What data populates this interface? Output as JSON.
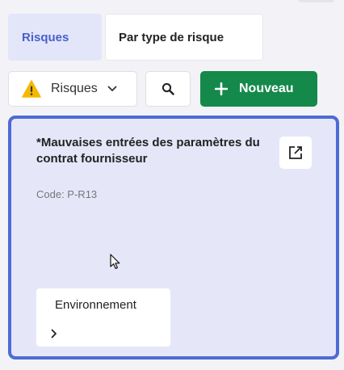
{
  "tabs": [
    {
      "label": "Risques",
      "active": true
    },
    {
      "label": "Par type de risque",
      "active": false
    }
  ],
  "toolbar": {
    "select_label": "Risques",
    "select_icon": "warning-icon",
    "search_icon": "search-icon",
    "new_label": "Nouveau",
    "new_icon": "plus-icon"
  },
  "card": {
    "title": "*Mauvaises entrées des paramètres du contrat fournisseur",
    "code": "Code: P-R13",
    "open_icon": "open-external-icon",
    "tag": {
      "label": "Environnement",
      "icon": "chevron-right-icon"
    }
  },
  "colors": {
    "accent": "#4d6bd4",
    "tab_active_text": "#4a61c8",
    "primary_button": "#14894a",
    "card_background": "#e5e7f9",
    "warning": "#f5b800"
  }
}
